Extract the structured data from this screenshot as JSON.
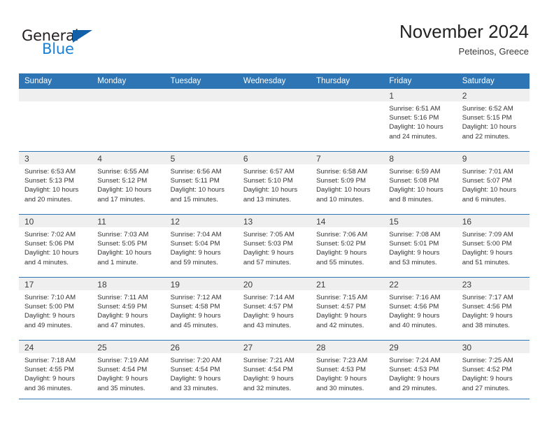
{
  "logo": {
    "word_top": "General",
    "word_bottom": "Blue",
    "mark": "triangle-mark"
  },
  "header": {
    "title": "November 2024",
    "location": "Peteinos, Greece"
  },
  "colors": {
    "header_blue": "#2e75b6",
    "daynum_band": "#efefef",
    "logo_blue": "#1b7fd4",
    "text": "#333333"
  },
  "weekdays": [
    "Sunday",
    "Monday",
    "Tuesday",
    "Wednesday",
    "Thursday",
    "Friday",
    "Saturday"
  ],
  "weeks": [
    [
      {
        "day": "",
        "sunrise": "",
        "sunset": "",
        "daylight": "",
        "daylight2": ""
      },
      {
        "day": "",
        "sunrise": "",
        "sunset": "",
        "daylight": "",
        "daylight2": ""
      },
      {
        "day": "",
        "sunrise": "",
        "sunset": "",
        "daylight": "",
        "daylight2": ""
      },
      {
        "day": "",
        "sunrise": "",
        "sunset": "",
        "daylight": "",
        "daylight2": ""
      },
      {
        "day": "",
        "sunrise": "",
        "sunset": "",
        "daylight": "",
        "daylight2": ""
      },
      {
        "day": "1",
        "sunrise": "Sunrise: 6:51 AM",
        "sunset": "Sunset: 5:16 PM",
        "daylight": "Daylight: 10 hours",
        "daylight2": "and 24 minutes."
      },
      {
        "day": "2",
        "sunrise": "Sunrise: 6:52 AM",
        "sunset": "Sunset: 5:15 PM",
        "daylight": "Daylight: 10 hours",
        "daylight2": "and 22 minutes."
      }
    ],
    [
      {
        "day": "3",
        "sunrise": "Sunrise: 6:53 AM",
        "sunset": "Sunset: 5:13 PM",
        "daylight": "Daylight: 10 hours",
        "daylight2": "and 20 minutes."
      },
      {
        "day": "4",
        "sunrise": "Sunrise: 6:55 AM",
        "sunset": "Sunset: 5:12 PM",
        "daylight": "Daylight: 10 hours",
        "daylight2": "and 17 minutes."
      },
      {
        "day": "5",
        "sunrise": "Sunrise: 6:56 AM",
        "sunset": "Sunset: 5:11 PM",
        "daylight": "Daylight: 10 hours",
        "daylight2": "and 15 minutes."
      },
      {
        "day": "6",
        "sunrise": "Sunrise: 6:57 AM",
        "sunset": "Sunset: 5:10 PM",
        "daylight": "Daylight: 10 hours",
        "daylight2": "and 13 minutes."
      },
      {
        "day": "7",
        "sunrise": "Sunrise: 6:58 AM",
        "sunset": "Sunset: 5:09 PM",
        "daylight": "Daylight: 10 hours",
        "daylight2": "and 10 minutes."
      },
      {
        "day": "8",
        "sunrise": "Sunrise: 6:59 AM",
        "sunset": "Sunset: 5:08 PM",
        "daylight": "Daylight: 10 hours",
        "daylight2": "and 8 minutes."
      },
      {
        "day": "9",
        "sunrise": "Sunrise: 7:01 AM",
        "sunset": "Sunset: 5:07 PM",
        "daylight": "Daylight: 10 hours",
        "daylight2": "and 6 minutes."
      }
    ],
    [
      {
        "day": "10",
        "sunrise": "Sunrise: 7:02 AM",
        "sunset": "Sunset: 5:06 PM",
        "daylight": "Daylight: 10 hours",
        "daylight2": "and 4 minutes."
      },
      {
        "day": "11",
        "sunrise": "Sunrise: 7:03 AM",
        "sunset": "Sunset: 5:05 PM",
        "daylight": "Daylight: 10 hours",
        "daylight2": "and 1 minute."
      },
      {
        "day": "12",
        "sunrise": "Sunrise: 7:04 AM",
        "sunset": "Sunset: 5:04 PM",
        "daylight": "Daylight: 9 hours",
        "daylight2": "and 59 minutes."
      },
      {
        "day": "13",
        "sunrise": "Sunrise: 7:05 AM",
        "sunset": "Sunset: 5:03 PM",
        "daylight": "Daylight: 9 hours",
        "daylight2": "and 57 minutes."
      },
      {
        "day": "14",
        "sunrise": "Sunrise: 7:06 AM",
        "sunset": "Sunset: 5:02 PM",
        "daylight": "Daylight: 9 hours",
        "daylight2": "and 55 minutes."
      },
      {
        "day": "15",
        "sunrise": "Sunrise: 7:08 AM",
        "sunset": "Sunset: 5:01 PM",
        "daylight": "Daylight: 9 hours",
        "daylight2": "and 53 minutes."
      },
      {
        "day": "16",
        "sunrise": "Sunrise: 7:09 AM",
        "sunset": "Sunset: 5:00 PM",
        "daylight": "Daylight: 9 hours",
        "daylight2": "and 51 minutes."
      }
    ],
    [
      {
        "day": "17",
        "sunrise": "Sunrise: 7:10 AM",
        "sunset": "Sunset: 5:00 PM",
        "daylight": "Daylight: 9 hours",
        "daylight2": "and 49 minutes."
      },
      {
        "day": "18",
        "sunrise": "Sunrise: 7:11 AM",
        "sunset": "Sunset: 4:59 PM",
        "daylight": "Daylight: 9 hours",
        "daylight2": "and 47 minutes."
      },
      {
        "day": "19",
        "sunrise": "Sunrise: 7:12 AM",
        "sunset": "Sunset: 4:58 PM",
        "daylight": "Daylight: 9 hours",
        "daylight2": "and 45 minutes."
      },
      {
        "day": "20",
        "sunrise": "Sunrise: 7:14 AM",
        "sunset": "Sunset: 4:57 PM",
        "daylight": "Daylight: 9 hours",
        "daylight2": "and 43 minutes."
      },
      {
        "day": "21",
        "sunrise": "Sunrise: 7:15 AM",
        "sunset": "Sunset: 4:57 PM",
        "daylight": "Daylight: 9 hours",
        "daylight2": "and 42 minutes."
      },
      {
        "day": "22",
        "sunrise": "Sunrise: 7:16 AM",
        "sunset": "Sunset: 4:56 PM",
        "daylight": "Daylight: 9 hours",
        "daylight2": "and 40 minutes."
      },
      {
        "day": "23",
        "sunrise": "Sunrise: 7:17 AM",
        "sunset": "Sunset: 4:56 PM",
        "daylight": "Daylight: 9 hours",
        "daylight2": "and 38 minutes."
      }
    ],
    [
      {
        "day": "24",
        "sunrise": "Sunrise: 7:18 AM",
        "sunset": "Sunset: 4:55 PM",
        "daylight": "Daylight: 9 hours",
        "daylight2": "and 36 minutes."
      },
      {
        "day": "25",
        "sunrise": "Sunrise: 7:19 AM",
        "sunset": "Sunset: 4:54 PM",
        "daylight": "Daylight: 9 hours",
        "daylight2": "and 35 minutes."
      },
      {
        "day": "26",
        "sunrise": "Sunrise: 7:20 AM",
        "sunset": "Sunset: 4:54 PM",
        "daylight": "Daylight: 9 hours",
        "daylight2": "and 33 minutes."
      },
      {
        "day": "27",
        "sunrise": "Sunrise: 7:21 AM",
        "sunset": "Sunset: 4:54 PM",
        "daylight": "Daylight: 9 hours",
        "daylight2": "and 32 minutes."
      },
      {
        "day": "28",
        "sunrise": "Sunrise: 7:23 AM",
        "sunset": "Sunset: 4:53 PM",
        "daylight": "Daylight: 9 hours",
        "daylight2": "and 30 minutes."
      },
      {
        "day": "29",
        "sunrise": "Sunrise: 7:24 AM",
        "sunset": "Sunset: 4:53 PM",
        "daylight": "Daylight: 9 hours",
        "daylight2": "and 29 minutes."
      },
      {
        "day": "30",
        "sunrise": "Sunrise: 7:25 AM",
        "sunset": "Sunset: 4:52 PM",
        "daylight": "Daylight: 9 hours",
        "daylight2": "and 27 minutes."
      }
    ]
  ]
}
